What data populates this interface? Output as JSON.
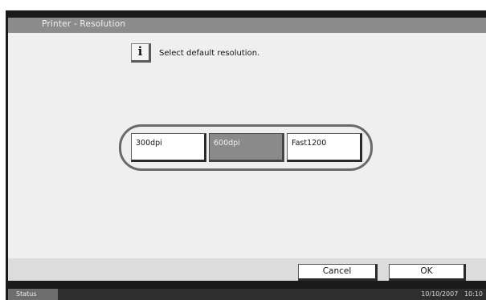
{
  "title": "Printer - Resolution",
  "message": "Select default resolution.",
  "info_icon": "info-icon",
  "resolution_options": [
    {
      "label": "300dpi",
      "selected": false
    },
    {
      "label": "600dpi",
      "selected": true
    },
    {
      "label": "Fast1200",
      "selected": false
    }
  ],
  "buttons": {
    "cancel": "Cancel",
    "ok": "OK"
  },
  "statusbar": {
    "status_label": "Status",
    "date": "10/10/2007",
    "time": "10:10"
  },
  "colors": {
    "titlebar": "#8c8c8c",
    "selected_button": "#8a8a8a",
    "background": "#efefef"
  }
}
